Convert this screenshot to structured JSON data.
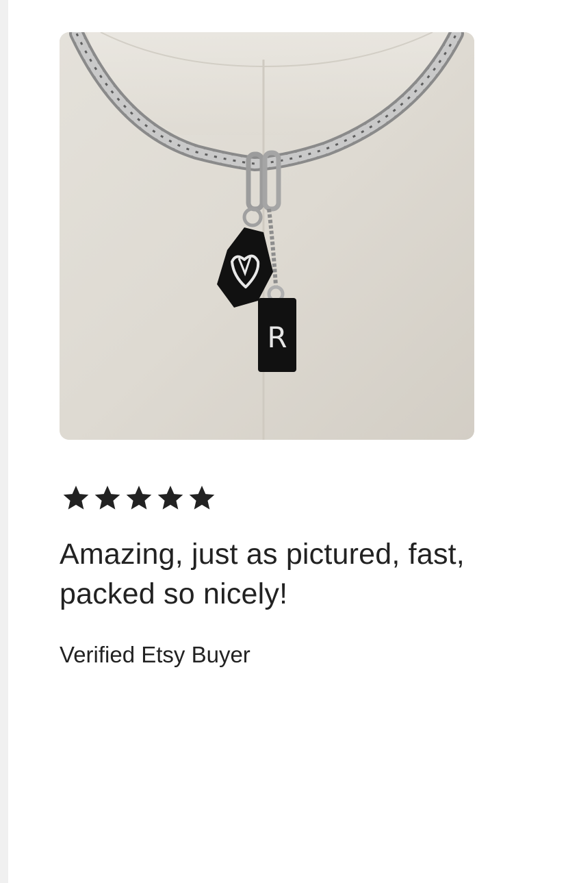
{
  "review": {
    "rating": 5,
    "rating_max": 5,
    "text": "Amazing, just as pictured, fast, packed so nicely!",
    "reviewer": "Verified Etsy Buyer"
  },
  "photo": {
    "pendant_letter": "R"
  },
  "colors": {
    "text": "#222222",
    "star": "#222222",
    "background": "#ffffff",
    "left_edge": "#f0f0f0"
  },
  "icons": {
    "rating": "star-icon"
  }
}
